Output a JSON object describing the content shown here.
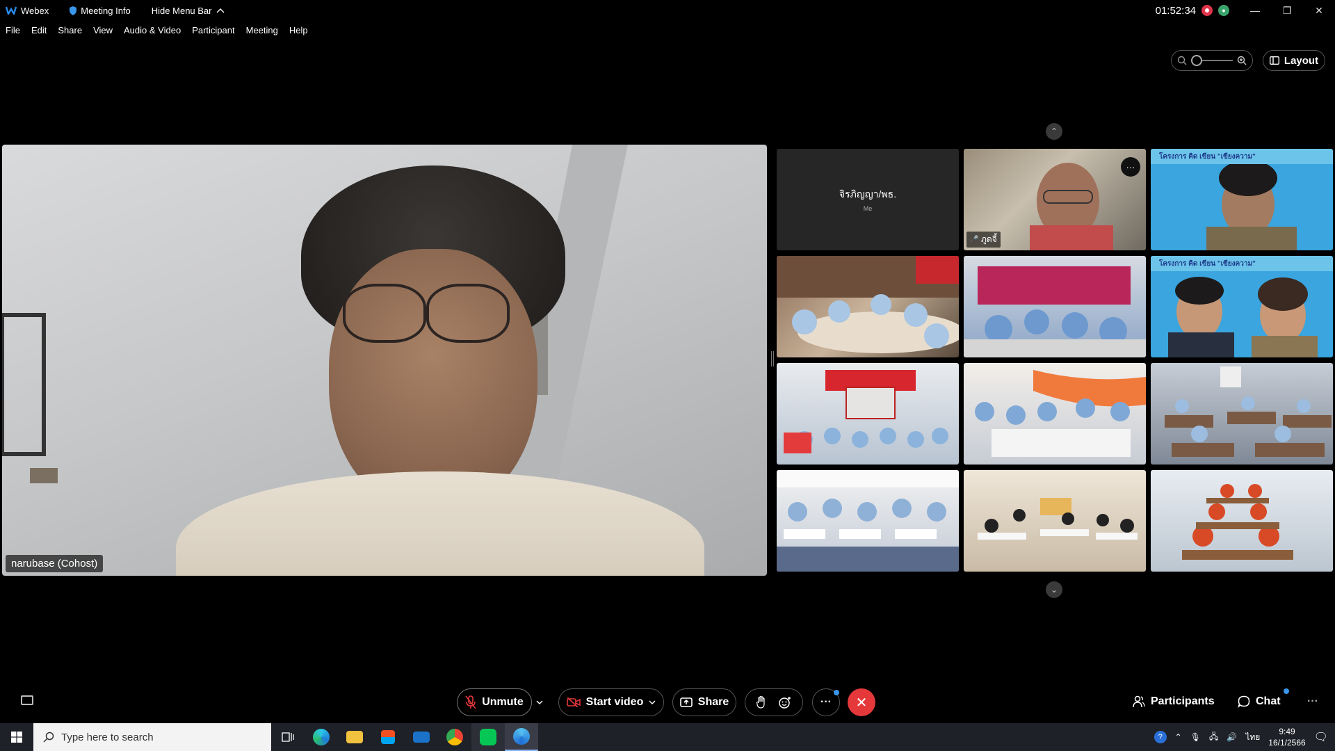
{
  "titlebar": {
    "app_name": "Webex",
    "meeting_info": "Meeting Info",
    "hide_menu_bar": "Hide Menu Bar",
    "time": "01:52:34"
  },
  "menu": [
    "File",
    "Edit",
    "Share",
    "View",
    "Audio & Video",
    "Participant",
    "Meeting",
    "Help"
  ],
  "top_controls": {
    "layout_label": "Layout"
  },
  "main_video": {
    "speaker_name": "narubase (Cohost)"
  },
  "gallery": {
    "self_tile": {
      "name": "จิรภิญญา/พธ.",
      "sub": "Me"
    },
    "tile_2_name": "ภูดจี้",
    "banner_text": "โครงการ คิด เขียน \"เขียงความ\"",
    "tiles": [
      {
        "scene": "classroom-a"
      },
      {
        "scene": "classroom-b"
      },
      {
        "scene": "video-call-duo"
      },
      {
        "scene": "classroom-c"
      },
      {
        "scene": "classroom-d"
      },
      {
        "scene": "classroom-e"
      },
      {
        "scene": "classroom-f"
      },
      {
        "scene": "classroom-g"
      },
      {
        "scene": "classroom-h"
      }
    ]
  },
  "controls": {
    "unmute": "Unmute",
    "start_video": "Start video",
    "share": "Share",
    "participants": "Participants",
    "chat": "Chat"
  },
  "taskbar": {
    "search_placeholder": "Type here to search",
    "tray_lang": "ไทย",
    "tray_time": "9:49",
    "tray_date": "16/1/2566"
  },
  "colors": {
    "end_call": "#e5383b",
    "record": "#e0334a",
    "accent_blue": "#3a96ea",
    "taskbar": "#1f2128"
  }
}
